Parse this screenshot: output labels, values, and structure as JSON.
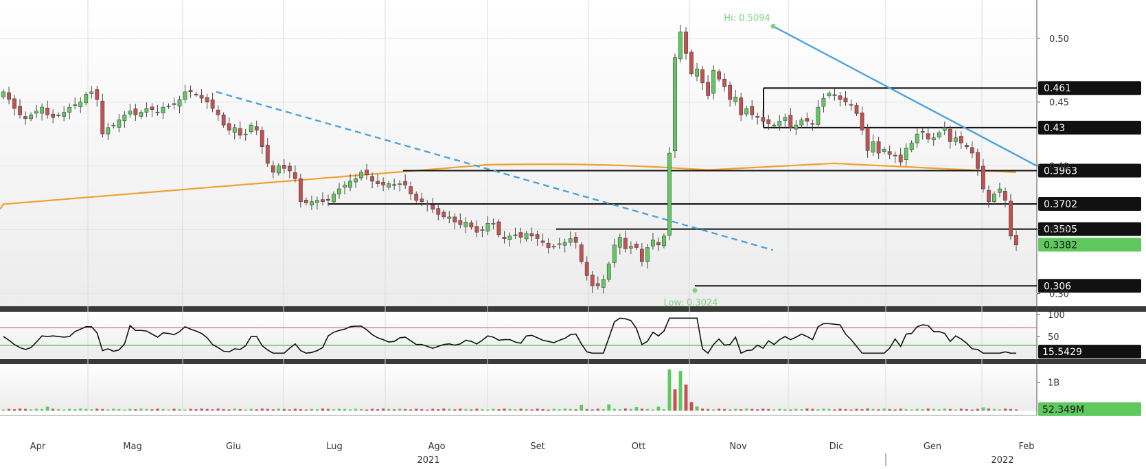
{
  "chart_data": {
    "type": "candlestick",
    "x_month_labels": [
      "Apr",
      "Mag",
      "Giu",
      "Lug",
      "Ago",
      "Set",
      "Ott",
      "Nov",
      "Dic",
      "Gen",
      "Feb"
    ],
    "x_year_labels": [
      "2021",
      "2022"
    ],
    "price": {
      "ylim": [
        0.29,
        0.53
      ],
      "tick_labels": [
        "0.50",
        "0.45",
        "0.40",
        "0.35",
        "0.30"
      ],
      "current_value": "0.3382",
      "hi_label": "Hi: 0.5094",
      "low_label": "Low: 0.3024",
      "horizontal_levels": [
        {
          "value": 0.461,
          "label": "0.461"
        },
        {
          "value": 0.43,
          "label": "0.43"
        },
        {
          "value": 0.3963,
          "label": "0.3963"
        },
        {
          "value": 0.3702,
          "label": "0.3702"
        },
        {
          "value": 0.3505,
          "label": "0.3505"
        },
        {
          "value": 0.306,
          "label": "0.306"
        }
      ],
      "moving_average_color": "#f0a030",
      "up_color": "#5fc85f",
      "down_color": "#c45050",
      "trendline_color": "#4aa3df",
      "closes": [
        0.458,
        0.452,
        0.445,
        0.44,
        0.437,
        0.44,
        0.443,
        0.446,
        0.44,
        0.438,
        0.44,
        0.442,
        0.446,
        0.448,
        0.45,
        0.456,
        0.458,
        0.452,
        0.425,
        0.43,
        0.432,
        0.436,
        0.44,
        0.443,
        0.44,
        0.442,
        0.445,
        0.444,
        0.442,
        0.446,
        0.447,
        0.448,
        0.452,
        0.458,
        0.458,
        0.456,
        0.453,
        0.45,
        0.445,
        0.44,
        0.432,
        0.428,
        0.43,
        0.424,
        0.425,
        0.432,
        0.428,
        0.415,
        0.402,
        0.395,
        0.4,
        0.398,
        0.396,
        0.39,
        0.372,
        0.371,
        0.372,
        0.373,
        0.372,
        0.373,
        0.378,
        0.382,
        0.385,
        0.388,
        0.39,
        0.395,
        0.393,
        0.388,
        0.386,
        0.385,
        0.386,
        0.385,
        0.386,
        0.385,
        0.378,
        0.373,
        0.372,
        0.37,
        0.366,
        0.362,
        0.36,
        0.36,
        0.356,
        0.354,
        0.356,
        0.352,
        0.348,
        0.35,
        0.355,
        0.355,
        0.346,
        0.343,
        0.345,
        0.346,
        0.344,
        0.347,
        0.345,
        0.343,
        0.34,
        0.336,
        0.337,
        0.339,
        0.34,
        0.343,
        0.34,
        0.325,
        0.314,
        0.306,
        0.306,
        0.311,
        0.323,
        0.338,
        0.344,
        0.335,
        0.337,
        0.336,
        0.325,
        0.336,
        0.342,
        0.338,
        0.345,
        0.41,
        0.485,
        0.505,
        0.488,
        0.472,
        0.476,
        0.465,
        0.455,
        0.475,
        0.468,
        0.462,
        0.452,
        0.454,
        0.44,
        0.445,
        0.44,
        0.438,
        0.435,
        0.433,
        0.432,
        0.435,
        0.438,
        0.43,
        0.432,
        0.436,
        0.435,
        0.433,
        0.446,
        0.453,
        0.457,
        0.455,
        0.452,
        0.45,
        0.448,
        0.441,
        0.428,
        0.412,
        0.419,
        0.41,
        0.413,
        0.409,
        0.408,
        0.403,
        0.414,
        0.418,
        0.425,
        0.427,
        0.421,
        0.422,
        0.426,
        0.43,
        0.419,
        0.422,
        0.418,
        0.415,
        0.41,
        0.398,
        0.382,
        0.372,
        0.378,
        0.382,
        0.373,
        0.345,
        0.338
      ]
    },
    "rsi": {
      "ylim": [
        0,
        105
      ],
      "tick_labels": [
        "100",
        "50",
        "0"
      ],
      "overbought": 70,
      "oversold": 30,
      "current_value": "15.5429"
    },
    "volume": {
      "tick_labels": [
        "1B"
      ],
      "current_value": "52.349M",
      "spikes": [
        {
          "day": 121,
          "value": 1.45,
          "up": true
        },
        {
          "day": 122,
          "value": 0.75,
          "up": false
        },
        {
          "day": 123,
          "value": 1.4,
          "up": true
        },
        {
          "day": 124,
          "value": 0.92,
          "up": false
        },
        {
          "day": 125,
          "value": 0.3,
          "up": false
        },
        {
          "day": 126,
          "value": 0.15,
          "up": true
        },
        {
          "day": 110,
          "value": 0.22,
          "up": true
        },
        {
          "day": 105,
          "value": 0.2,
          "up": true
        },
        {
          "day": 115,
          "value": 0.12,
          "up": true
        },
        {
          "day": 119,
          "value": 0.14,
          "up": true
        },
        {
          "day": 8,
          "value": 0.14,
          "up": true
        },
        {
          "day": 178,
          "value": 0.11,
          "up": true
        }
      ]
    }
  }
}
